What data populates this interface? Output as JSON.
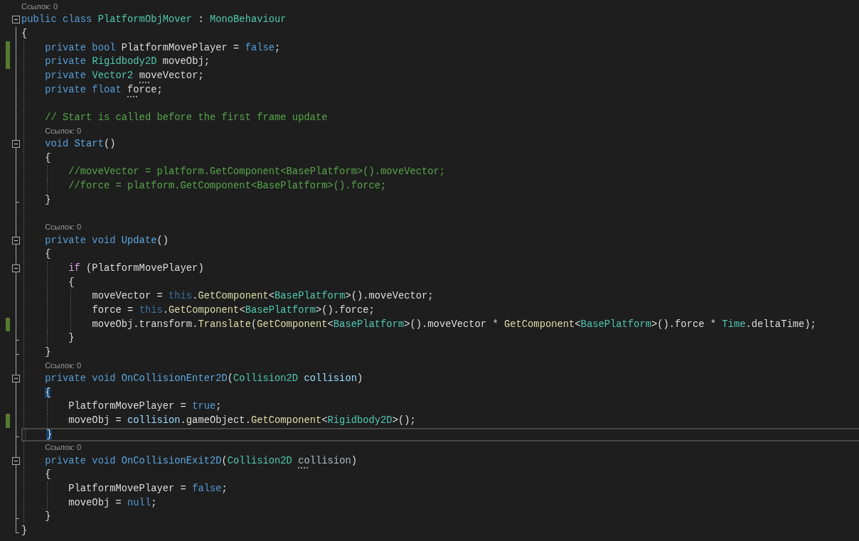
{
  "lines": [
    {
      "kind": "lens",
      "text": "Ссылок: 0"
    },
    {
      "kind": "code",
      "expanded": true,
      "tokens": [
        {
          "kind": "keyword",
          "text": "public class "
        },
        {
          "kind": "type",
          "text": "PlatformObjMover"
        },
        {
          "kind": "plain",
          "text": " : "
        },
        {
          "kind": "type",
          "text": "MonoBehaviour"
        }
      ]
    },
    {
      "kind": "code",
      "tokens": [
        {
          "kind": "plain",
          "text": "{"
        }
      ]
    },
    {
      "kind": "code",
      "changed": true,
      "tokens": [
        {
          "kind": "keyword",
          "text": "    private bool "
        },
        {
          "kind": "plain",
          "text": "PlatformMovePlayer = "
        },
        {
          "kind": "keyword",
          "text": "false"
        },
        {
          "kind": "plain",
          "text": ";"
        }
      ]
    },
    {
      "kind": "code",
      "changed": true,
      "tokens": [
        {
          "kind": "keyword",
          "text": "    private "
        },
        {
          "kind": "type",
          "text": "Rigidbody2D"
        },
        {
          "kind": "plain",
          "text": " moveObj;"
        }
      ]
    },
    {
      "kind": "code",
      "tokens": [
        {
          "kind": "keyword",
          "text": "    private "
        },
        {
          "kind": "type",
          "text": "Vector2 "
        },
        {
          "kind": "plain",
          "text": "moveVector",
          "hint": true
        },
        {
          "kind": "plain",
          "text": ";"
        }
      ]
    },
    {
      "kind": "code",
      "tokens": [
        {
          "kind": "keyword",
          "text": "    private float "
        },
        {
          "kind": "plain",
          "text": "force",
          "hint": true
        },
        {
          "kind": "plain",
          "text": ";"
        }
      ]
    },
    {
      "kind": "blank"
    },
    {
      "kind": "code",
      "tokens": [
        {
          "kind": "comment",
          "text": "    // Start is called before the first frame update"
        }
      ]
    },
    {
      "kind": "lens",
      "text": "Ссылок: 0"
    },
    {
      "kind": "code",
      "expanded": true,
      "tokens": [
        {
          "kind": "keyword",
          "text": "    void "
        },
        {
          "kind": "message",
          "text": "Start"
        },
        {
          "kind": "plain",
          "text": "()"
        }
      ]
    },
    {
      "kind": "code",
      "tokens": [
        {
          "kind": "plain",
          "text": "    {"
        }
      ]
    },
    {
      "kind": "code",
      "tokens": [
        {
          "kind": "comment",
          "text": "        //moveVector = platform.GetComponent<BasePlatform>().moveVector;"
        }
      ]
    },
    {
      "kind": "code",
      "tokens": [
        {
          "kind": "comment",
          "text": "        //force = platform.GetComponent<BasePlatform>().force;"
        }
      ]
    },
    {
      "kind": "code",
      "block_end": true,
      "tokens": [
        {
          "kind": "plain",
          "text": "    }"
        }
      ]
    },
    {
      "kind": "blank"
    },
    {
      "kind": "lens",
      "text": "Ссылок: 0"
    },
    {
      "kind": "code",
      "expanded": true,
      "tokens": [
        {
          "kind": "keyword",
          "text": "    private void "
        },
        {
          "kind": "message",
          "text": "Update"
        },
        {
          "kind": "plain",
          "text": "()"
        }
      ]
    },
    {
      "kind": "code",
      "tokens": [
        {
          "kind": "plain",
          "text": "    {"
        }
      ]
    },
    {
      "kind": "code",
      "expanded": true,
      "tokens": [
        {
          "kind": "control",
          "text": "        if"
        },
        {
          "kind": "plain",
          "text": " (PlatformMovePlayer)"
        }
      ]
    },
    {
      "kind": "code",
      "tokens": [
        {
          "kind": "plain",
          "text": "        {"
        }
      ]
    },
    {
      "kind": "code",
      "tokens": [
        {
          "kind": "plain",
          "text": "            moveVector = "
        },
        {
          "kind": "faded",
          "text": "this"
        },
        {
          "kind": "plain",
          "text": "."
        },
        {
          "kind": "method",
          "text": "GetComponent"
        },
        {
          "kind": "plain",
          "text": "<"
        },
        {
          "kind": "type",
          "text": "BasePlatform"
        },
        {
          "kind": "plain",
          "text": ">().moveVector;"
        }
      ]
    },
    {
      "kind": "code",
      "tokens": [
        {
          "kind": "plain",
          "text": "            force = "
        },
        {
          "kind": "faded",
          "text": "this"
        },
        {
          "kind": "plain",
          "text": "."
        },
        {
          "kind": "method",
          "text": "GetComponent"
        },
        {
          "kind": "plain",
          "text": "<"
        },
        {
          "kind": "type",
          "text": "BasePlatform"
        },
        {
          "kind": "plain",
          "text": ">().force;"
        }
      ]
    },
    {
      "kind": "code",
      "changed": true,
      "tokens": [
        {
          "kind": "plain",
          "text": "            moveObj.transform."
        },
        {
          "kind": "method",
          "text": "Translate"
        },
        {
          "kind": "plain",
          "text": "("
        },
        {
          "kind": "method",
          "text": "GetComponent"
        },
        {
          "kind": "plain",
          "text": "<"
        },
        {
          "kind": "type",
          "text": "BasePlatform"
        },
        {
          "kind": "plain",
          "text": ">().moveVector * "
        },
        {
          "kind": "method",
          "text": "GetComponent"
        },
        {
          "kind": "plain",
          "text": "<"
        },
        {
          "kind": "type",
          "text": "BasePlatform"
        },
        {
          "kind": "plain",
          "text": ">().force * "
        },
        {
          "kind": "type",
          "text": "Time"
        },
        {
          "kind": "plain",
          "text": ".deltaTime);"
        }
      ]
    },
    {
      "kind": "code",
      "block_end": true,
      "tokens": [
        {
          "kind": "plain",
          "text": "        }"
        }
      ]
    },
    {
      "kind": "code",
      "block_end": true,
      "tokens": [
        {
          "kind": "plain",
          "text": "    }"
        }
      ]
    },
    {
      "kind": "lens",
      "text": "Ссылок: 0"
    },
    {
      "kind": "code",
      "expanded": true,
      "tokens": [
        {
          "kind": "keyword",
          "text": "    private void "
        },
        {
          "kind": "message",
          "text": "OnCollisionEnter2D"
        },
        {
          "kind": "plain",
          "text": "("
        },
        {
          "kind": "type",
          "text": "Collision2D "
        },
        {
          "kind": "param",
          "text": "collision"
        },
        {
          "kind": "plain",
          "text": ")"
        }
      ]
    },
    {
      "kind": "code",
      "tokens": [
        {
          "kind": "plain",
          "text": "    {",
          "matched": true
        }
      ]
    },
    {
      "kind": "code",
      "tokens": [
        {
          "kind": "plain",
          "text": "        PlatformMovePlayer = "
        },
        {
          "kind": "keyword",
          "text": "true"
        },
        {
          "kind": "plain",
          "text": ";"
        }
      ]
    },
    {
      "kind": "code",
      "changed": true,
      "tokens": [
        {
          "kind": "plain",
          "text": "        moveObj = "
        },
        {
          "kind": "param",
          "text": "collision"
        },
        {
          "kind": "plain",
          "text": ".gameObject."
        },
        {
          "kind": "method",
          "text": "GetComponent"
        },
        {
          "kind": "plain",
          "text": "<"
        },
        {
          "kind": "type",
          "text": "Rigidbody2D"
        },
        {
          "kind": "plain",
          "text": ">();"
        }
      ]
    },
    {
      "kind": "code",
      "block_end": true,
      "current": true,
      "tokens": [
        {
          "kind": "plain",
          "text": "    }",
          "matched": true
        }
      ]
    },
    {
      "kind": "lens",
      "text": "Ссылок: 0"
    },
    {
      "kind": "code",
      "expanded": true,
      "tokens": [
        {
          "kind": "keyword",
          "text": "    private void "
        },
        {
          "kind": "message",
          "text": "OnCollisionExit2D"
        },
        {
          "kind": "plain",
          "text": "("
        },
        {
          "kind": "type",
          "text": "Collision2D "
        },
        {
          "kind": "unused",
          "text": "collision",
          "hint": true
        },
        {
          "kind": "plain",
          "text": ")"
        }
      ]
    },
    {
      "kind": "code",
      "tokens": [
        {
          "kind": "plain",
          "text": "    {"
        }
      ]
    },
    {
      "kind": "code",
      "tokens": [
        {
          "kind": "plain",
          "text": "        PlatformMovePlayer = "
        },
        {
          "kind": "keyword",
          "text": "false"
        },
        {
          "kind": "plain",
          "text": ";"
        }
      ]
    },
    {
      "kind": "code",
      "tokens": [
        {
          "kind": "plain",
          "text": "        moveObj = "
        },
        {
          "kind": "keyword",
          "text": "null"
        },
        {
          "kind": "plain",
          "text": ";"
        }
      ]
    },
    {
      "kind": "code",
      "block_end": true,
      "tokens": [
        {
          "kind": "plain",
          "text": "    }"
        }
      ]
    },
    {
      "kind": "code",
      "block_end": true,
      "tokens": [
        {
          "kind": "plain",
          "text": "}"
        }
      ]
    }
  ]
}
